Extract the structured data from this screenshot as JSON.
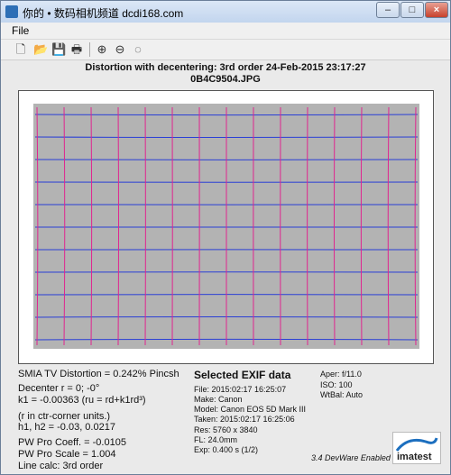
{
  "window": {
    "title": "你的 • 数码相机频道 dcdi168.com"
  },
  "menu": {
    "file": "File"
  },
  "toolbar": {
    "icons": [
      "new-icon",
      "open-icon",
      "save-icon",
      "print-icon",
      "zoom-in-icon",
      "zoom-out-icon",
      "reset-zoom-icon"
    ]
  },
  "plot": {
    "title": "Distortion with decentering:  3rd order      24-Feb-2015 23:17:27",
    "filename": "0B4C9504.JPG"
  },
  "results": {
    "tv": "SMIA TV Distortion = 0.242% Pincsh",
    "decenter": "Decenter r = 0;  -0°",
    "k1": "k1 = -0.00363  (ru = rd+k1rd³)",
    "units": "(r in ctr-corner units.)",
    "h": "h1, h2 = -0.03, 0.0217",
    "coeff": "PW Pro Coeff. = -0.0105",
    "scale": "PW Pro Scale = 1.004",
    "linecalc": "Line calc: 3rd order"
  },
  "exif": {
    "heading": "Selected EXIF data",
    "file": "File:  2015:02:17 16:25:07",
    "make": "Make:  Canon",
    "model": "Model: Canon EOS 5D Mark III",
    "taken": "Taken: 2015:02:17 16:25:06",
    "res": "Res:    5760 x 3840",
    "fl": "FL:   24.0mm",
    "exp": "Exp:   0.400 s  (1/2)",
    "aper": "Aper:  f/11.0",
    "iso": "ISO:    100",
    "wb": "WtBal: Auto"
  },
  "footer": {
    "version": "3.4  DevWare Enabled",
    "logo": "imatest"
  },
  "colors": {
    "horizontal": "#2a3fd6",
    "vertical": "#e0258f",
    "chart_bg": "#b3b3b3"
  }
}
